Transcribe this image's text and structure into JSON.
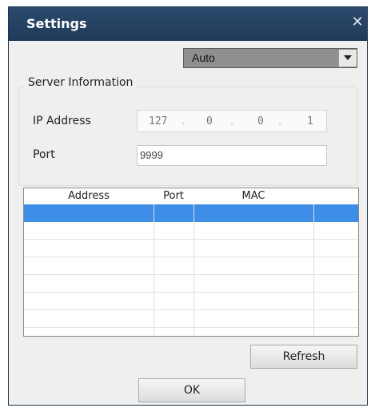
{
  "window": {
    "title": "Settings",
    "close_glyph": "✕"
  },
  "mode_select": {
    "value": "Auto"
  },
  "server_info": {
    "legend": "Server Information",
    "ip_label": "IP Address",
    "ip_octets": [
      "127",
      "0",
      "0",
      "1"
    ],
    "port_label": "Port",
    "port_value": "9999"
  },
  "device_table": {
    "columns": [
      "Address",
      "Port",
      "MAC"
    ],
    "rows": [
      [
        "",
        "",
        "",
        ""
      ],
      [
        "",
        "",
        "",
        ""
      ],
      [
        "",
        "",
        "",
        ""
      ],
      [
        "",
        "",
        "",
        ""
      ],
      [
        "",
        "",
        "",
        ""
      ],
      [
        "",
        "",
        "",
        ""
      ],
      [
        "",
        "",
        "",
        ""
      ]
    ],
    "selected_row": 0
  },
  "buttons": {
    "refresh": "Refresh",
    "ok": "OK"
  },
  "colors": {
    "titlebar": "#1f3a5a",
    "selection": "#3d8ee6"
  }
}
